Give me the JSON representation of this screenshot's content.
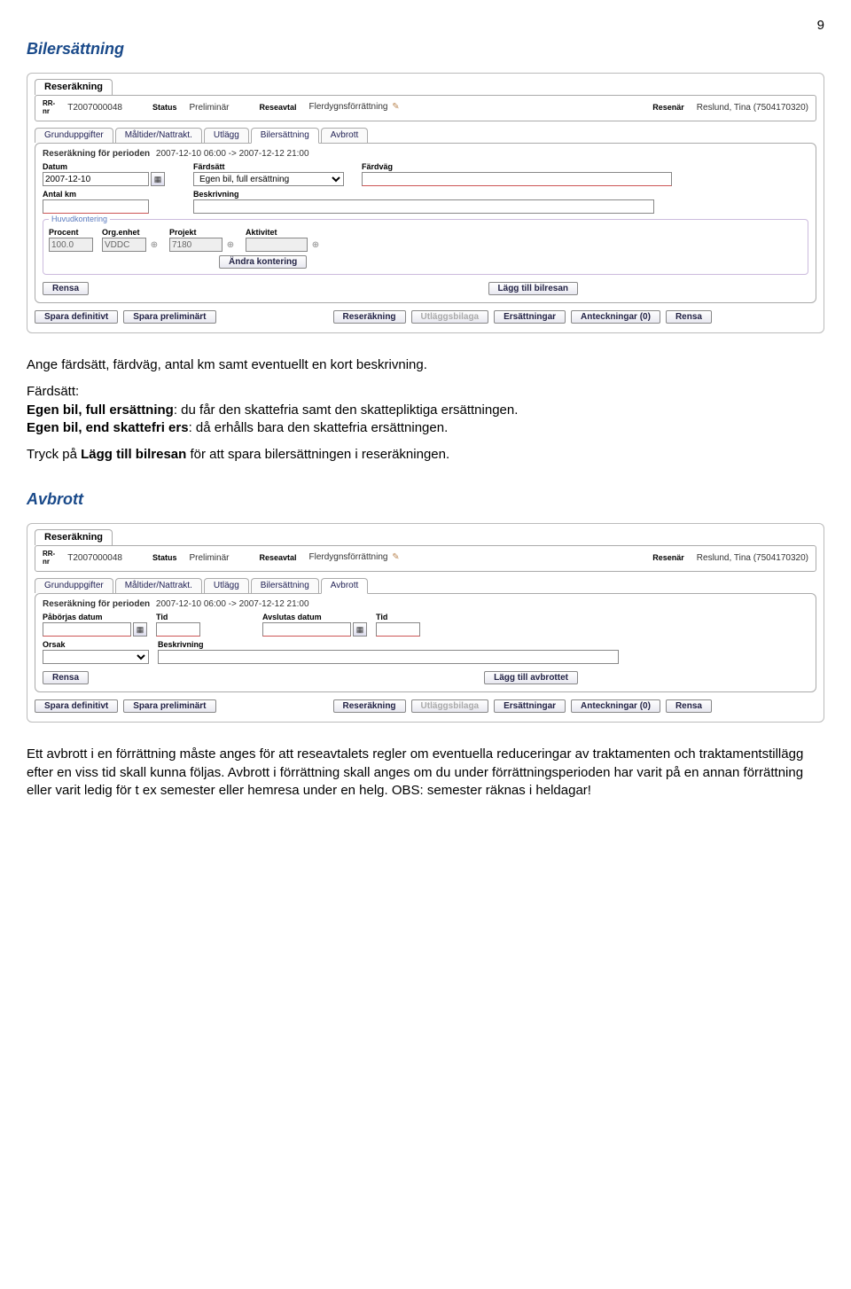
{
  "page_number": "9",
  "section1_title": "Bilersättning",
  "section2_title": "Avbrott",
  "frame1": {
    "main_tab": "Reseräkning",
    "rr_label": "RR-\nnr",
    "rr_value": "T2007000048",
    "status_label": "Status",
    "status_value": "Preliminär",
    "reseavtal_label": "Reseavtal",
    "reseavtal_value": "Flerdygnsförrättning",
    "resenar_label": "Resenär",
    "resenar_value": "Reslund, Tina (7504170320)",
    "tabs": [
      "Grunduppgifter",
      "Måltider/Nattrakt.",
      "Utlägg",
      "Bilersättning",
      "Avbrott"
    ],
    "active_tab_index": 3,
    "period_label": "Reseräkning för perioden",
    "period_value": "2007-12-10 06:00 -> 2007-12-12 21:00",
    "fields": {
      "datum_label": "Datum",
      "datum_value": "2007-12-10",
      "fardsatt_label": "Färdsätt",
      "fardsatt_value": "Egen bil, full ersättning",
      "fardvag_label": "Färdväg",
      "antal_km_label": "Antal km",
      "beskrivning_label": "Beskrivning"
    },
    "konto": {
      "box_title": "Huvudkontering",
      "procent_label": "Procent",
      "procent_value": "100.0",
      "org_label": "Org.enhet",
      "org_value": "VDDC",
      "projekt_label": "Projekt",
      "projekt_value": "7180",
      "aktivitet_label": "Aktivitet",
      "andra_btn": "Ändra kontering"
    },
    "btn_rensa": "Rensa",
    "btn_lagg_till": "Lägg till bilresan",
    "bottom": {
      "spara_def": "Spara definitivt",
      "spara_prel": "Spara preliminärt",
      "reserakning": "Reseräkning",
      "utlagg": "Utläggsbilaga",
      "ersattningar": "Ersättningar",
      "anteckningar": "Anteckningar (0)",
      "rensa": "Rensa"
    }
  },
  "frame2": {
    "main_tab": "Reseräkning",
    "rr_label": "RR-\nnr",
    "rr_value": "T2007000048",
    "status_label": "Status",
    "status_value": "Preliminär",
    "reseavtal_label": "Reseavtal",
    "reseavtal_value": "Flerdygnsförrättning",
    "resenar_label": "Resenär",
    "resenar_value": "Reslund, Tina (7504170320)",
    "tabs": [
      "Grunduppgifter",
      "Måltider/Nattrakt.",
      "Utlägg",
      "Bilersättning",
      "Avbrott"
    ],
    "active_tab_index": 4,
    "period_label": "Reseräkning för perioden",
    "period_value": "2007-12-10 06:00 -> 2007-12-12 21:00",
    "fields": {
      "pa_datum_label": "Påbörjas datum",
      "pa_tid_label": "Tid",
      "av_datum_label": "Avslutas datum",
      "av_tid_label": "Tid",
      "orsak_label": "Orsak",
      "beskrivning_label": "Beskrivning"
    },
    "btn_rensa": "Rensa",
    "btn_lagg_till": "Lägg till avbrottet",
    "bottom": {
      "spara_def": "Spara definitivt",
      "spara_prel": "Spara preliminärt",
      "reserakning": "Reseräkning",
      "utlagg": "Utläggsbilaga",
      "ersattningar": "Ersättningar",
      "anteckningar": "Anteckningar (0)",
      "rensa": "Rensa"
    }
  },
  "doc": {
    "p1": "Ange färdsätt, färdväg, antal km samt eventuellt en kort beskrivning.",
    "p2a": "Färdsätt:",
    "p2b_bold": "Egen bil, full ersättning",
    "p2b_rest": ": du får den skattefria samt den skattepliktiga ersättningen.",
    "p2c_bold": "Egen bil, end skattefri ers",
    "p2c_rest": ": då erhålls bara den skattefria ersättningen.",
    "p3a": "Tryck på ",
    "p3b_bold": "Lägg till bilresan",
    "p3c": " för att spara bilersättningen i reseräkningen.",
    "p4": "Ett avbrott i en förrättning måste anges för att reseavtalets regler om eventuella reduceringar av traktamenten och traktamentstillägg efter en viss tid skall kunna följas. Avbrott i förrättning skall anges om du under förrättnings­perioden har varit på en annan förrättning eller varit ledig för t ex semester eller hemresa under en helg. OBS: semester räknas i heldagar!"
  }
}
